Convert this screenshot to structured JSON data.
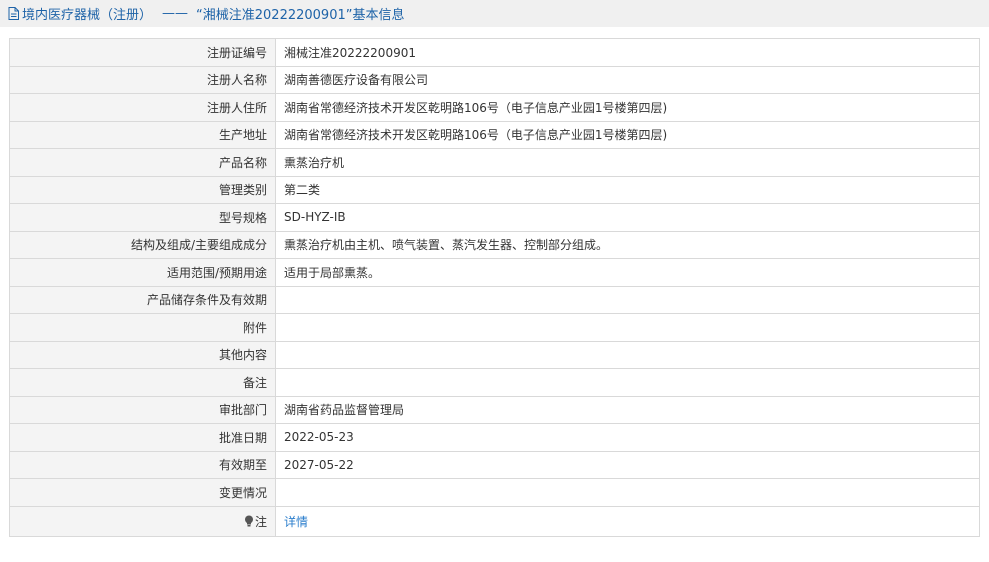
{
  "header": {
    "category": "境内医疗器械（注册）",
    "separator": "——",
    "title": "“湘械注准20222200901”基本信息"
  },
  "rows": [
    {
      "label": "注册证编号",
      "value": "湘械注准20222200901"
    },
    {
      "label": "注册人名称",
      "value": "湖南善德医疗设备有限公司"
    },
    {
      "label": "注册人住所",
      "value": "湖南省常德经济技术开发区乾明路106号（电子信息产业园1号楼第四层)"
    },
    {
      "label": "生产地址",
      "value": "湖南省常德经济技术开发区乾明路106号（电子信息产业园1号楼第四层)"
    },
    {
      "label": "产品名称",
      "value": "熏蒸治疗机"
    },
    {
      "label": "管理类别",
      "value": "第二类"
    },
    {
      "label": "型号规格",
      "value": "SD-HYZ-IB"
    },
    {
      "label": "结构及组成/主要组成成分",
      "value": "熏蒸治疗机由主机、喷气装置、蒸汽发生器、控制部分组成。"
    },
    {
      "label": "适用范围/预期用途",
      "value": "适用于局部熏蒸。"
    },
    {
      "label": "产品储存条件及有效期",
      "value": ""
    },
    {
      "label": "附件",
      "value": ""
    },
    {
      "label": "其他内容",
      "value": ""
    },
    {
      "label": "备注",
      "value": ""
    },
    {
      "label": "审批部门",
      "value": "湖南省药品监督管理局"
    },
    {
      "label": "批准日期",
      "value": "2022-05-23"
    },
    {
      "label": "有效期至",
      "value": "2027-05-22"
    },
    {
      "label": "变更情况",
      "value": ""
    }
  ],
  "note": {
    "label": "注",
    "link": "详情",
    "icon": "lightbulb-icon"
  },
  "colors": {
    "title": "#1e63a8",
    "link": "#2a7dcc",
    "label_bg": "#f4f4f4",
    "border": "#d9d9d9",
    "header_bg": "#f0f0f0"
  }
}
